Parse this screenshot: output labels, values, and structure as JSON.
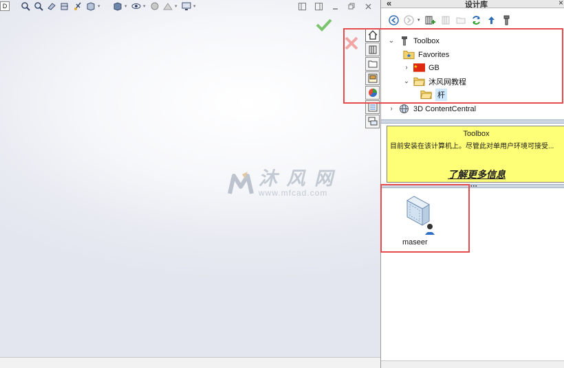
{
  "panel": {
    "title": "设计库",
    "collapse_glyph": "«",
    "close_glyph": "×"
  },
  "tree": {
    "items": [
      {
        "label": "Toolbox",
        "toggle": "⌄",
        "icon": "screw-icon"
      },
      {
        "label": "Favorites",
        "toggle": "",
        "icon": "favorites-folder-icon"
      },
      {
        "label": "GB",
        "toggle": "›",
        "icon": "china-flag-icon"
      },
      {
        "label": "沐风网教程",
        "toggle": "⌄",
        "icon": "folder-icon"
      },
      {
        "label": "杆",
        "toggle": "",
        "icon": "folder-open-icon"
      },
      {
        "label": "3D ContentCentral",
        "toggle": "›",
        "icon": "globe-icon"
      }
    ]
  },
  "info": {
    "title": "Toolbox",
    "description": "目前安装在该计算机上。尽管此对单用户环境可接受...",
    "link": "了解更多信息"
  },
  "library_items": [
    {
      "label": "maseer"
    }
  ],
  "watermark": {
    "title": "沐 风 网",
    "url": "www.mfcad.com"
  },
  "viewport": {
    "left_box": "D"
  },
  "colors": {
    "highlight": "#e64a4a",
    "info_bg": "#ffff77",
    "ok_green": "#7cc46b",
    "accent_blue": "#2f6db5"
  }
}
